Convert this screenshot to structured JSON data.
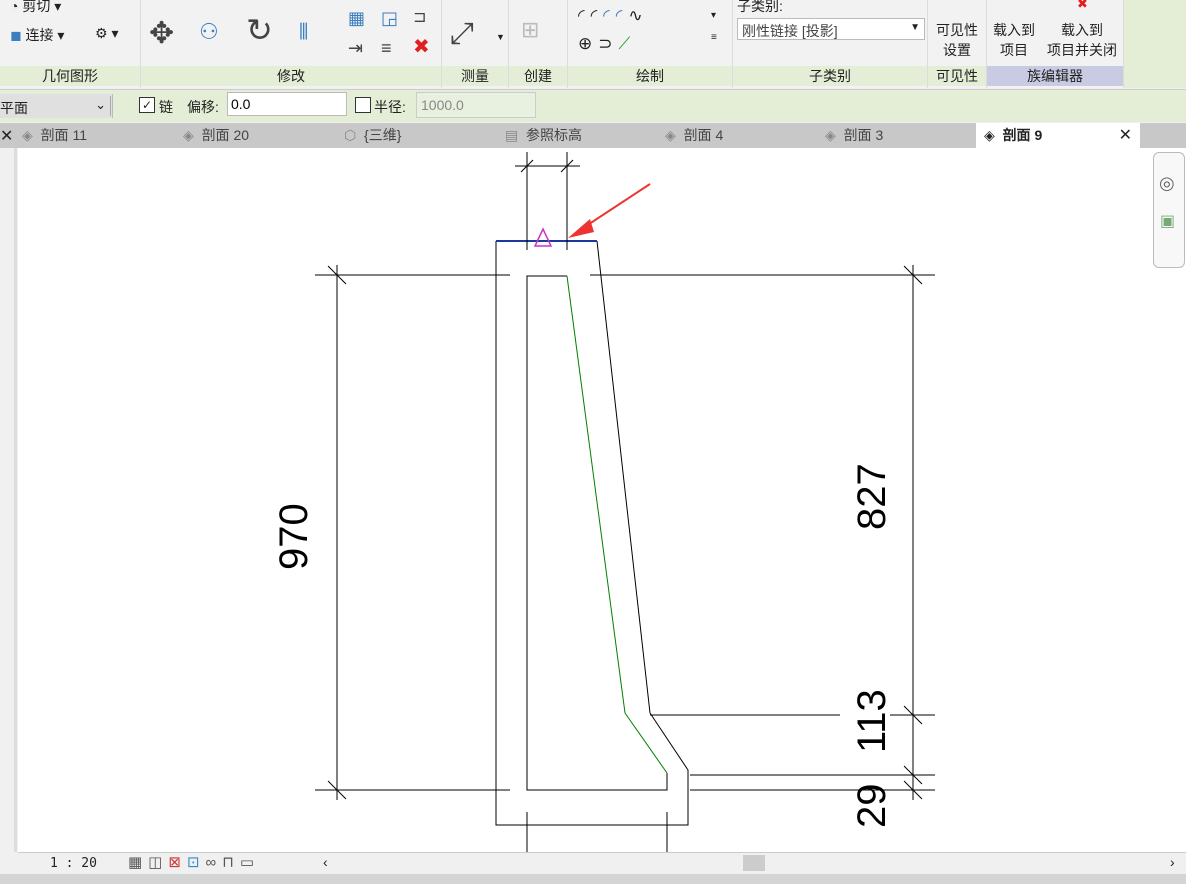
{
  "ribbon": {
    "geometry": {
      "label": "几何图形",
      "cut": "剪切",
      "join": "连接"
    },
    "modify": {
      "label": "修改"
    },
    "measure": {
      "label": "测量"
    },
    "create": {
      "label": "创建"
    },
    "draw": {
      "label": "绘制"
    },
    "subcategory": {
      "label": "子类别",
      "field_label": "子类别:",
      "value": "刚性链接 [投影]"
    },
    "visibility": {
      "label": "可见性",
      "button_line1": "可见性",
      "button_line2": "设置"
    },
    "family_editor": {
      "label": "族编辑器",
      "load_line1": "载入到",
      "load_line2": "项目",
      "load_close_line1": "载入到",
      "load_close_line2": "项目并关闭"
    }
  },
  "options": {
    "placement": "平面",
    "chain_label": "链",
    "chain_checked": true,
    "offset_label": "偏移:",
    "offset_value": "0.0",
    "radius_label": "半径:",
    "radius_checked": false,
    "radius_value": "1000.0"
  },
  "tabs": [
    {
      "label": "剖面 11"
    },
    {
      "label": "剖面 20"
    },
    {
      "label": "{三维}"
    },
    {
      "label": "参照标高"
    },
    {
      "label": "剖面 4"
    },
    {
      "label": "剖面 3"
    },
    {
      "label": "剖面 9",
      "active": true
    }
  ],
  "drawing": {
    "dims": {
      "total": "970",
      "upper": "827",
      "middle": "113",
      "lower": "29"
    }
  },
  "status": {
    "scale": "1 : 20"
  },
  "colors": {
    "ribbon_bg": "#e4eed6",
    "family_editor_bg": "#c9cbe3",
    "profile_green": "#008000",
    "arrow_red": "#ee3333",
    "ref_magenta": "#cc33cc"
  }
}
